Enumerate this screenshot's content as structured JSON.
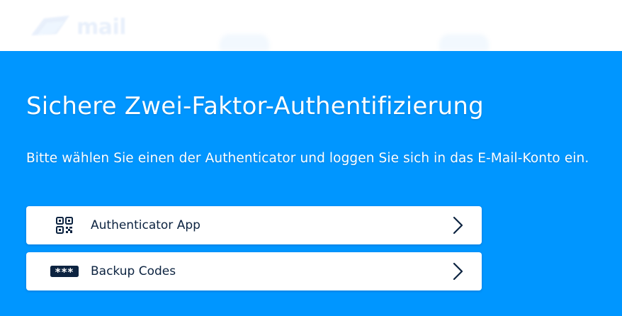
{
  "header": {
    "logo_text": "mail",
    "logo_icon": "brand-logo-icon"
  },
  "main": {
    "title": "Sichere Zwei-Faktor-Authentifizierung",
    "subtitle": "Bitte wählen Sie einen der Authenticator und loggen Sie sich in das E-Mail-Konto ein.",
    "options": [
      {
        "label": "Authenticator App",
        "icon": "qr-code-icon"
      },
      {
        "label": "Backup Codes",
        "icon": "asterisk-code-icon"
      }
    ]
  },
  "colors": {
    "background": "#0096ff",
    "header_background": "#ffffff",
    "card_background": "#ffffff",
    "text_dark": "#0c2340",
    "text_light": "#ffffff"
  }
}
